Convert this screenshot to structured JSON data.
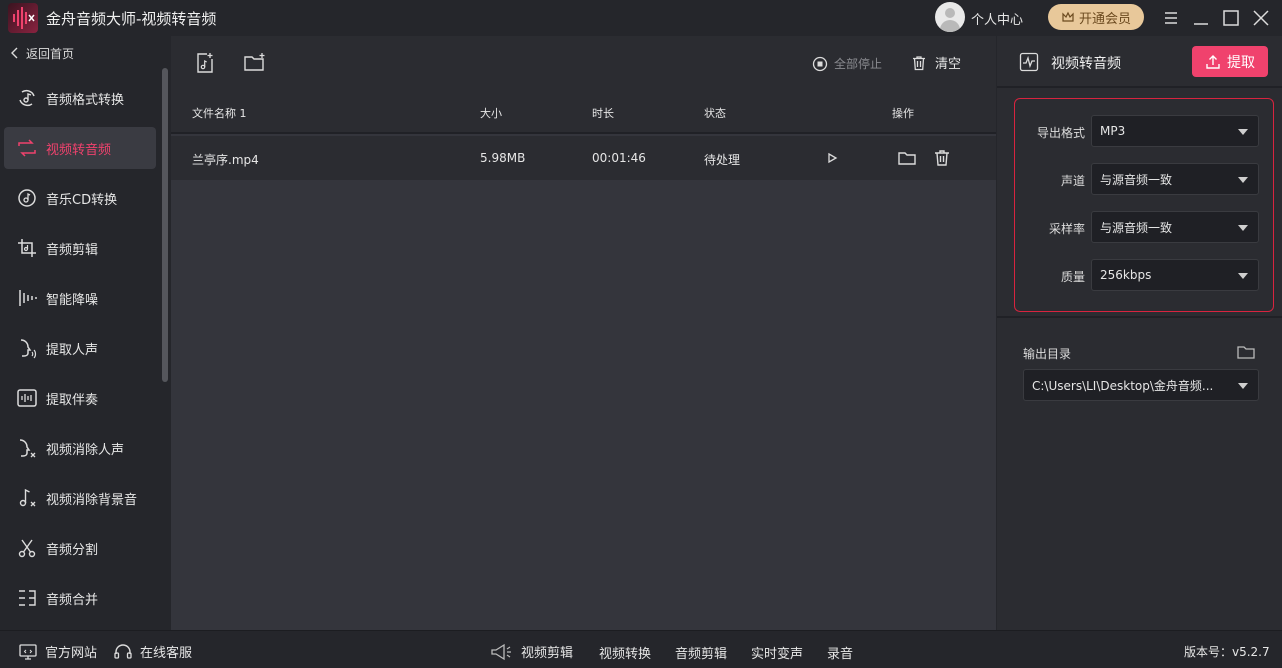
{
  "titlebar": {
    "app_title": "金舟音频大师-视频转音频",
    "user_center": "个人中心",
    "vip_button": "开通会员",
    "icons": [
      "menu-icon",
      "minimize-icon",
      "maximize-icon",
      "close-icon"
    ]
  },
  "sidebar": {
    "back_label": "返回首页",
    "items": [
      {
        "label": "音频格式转换",
        "icon": "audio-convert-icon",
        "active": false
      },
      {
        "label": "视频转音频",
        "icon": "video-to-audio-icon",
        "active": true
      },
      {
        "label": "音乐CD转换",
        "icon": "cd-icon",
        "active": false
      },
      {
        "label": "音频剪辑",
        "icon": "audio-cut-icon",
        "active": false
      },
      {
        "label": "智能降噪",
        "icon": "denoise-icon",
        "active": false
      },
      {
        "label": "提取人声",
        "icon": "vocal-extract-icon",
        "active": false
      },
      {
        "label": "提取伴奏",
        "icon": "accompaniment-icon",
        "active": false
      },
      {
        "label": "视频消除人声",
        "icon": "remove-vocal-icon",
        "active": false
      },
      {
        "label": "视频消除背景音",
        "icon": "remove-bg-sound-icon",
        "active": false
      },
      {
        "label": "音频分割",
        "icon": "split-icon",
        "active": false
      },
      {
        "label": "音频合并",
        "icon": "merge-icon",
        "active": false
      }
    ]
  },
  "toolbar": {
    "stop_all": "全部停止",
    "clear": "清空"
  },
  "table": {
    "headers": {
      "name": "文件名称 1",
      "size": "大小",
      "duration": "时长",
      "status": "状态",
      "actions": "操作"
    },
    "rows": [
      {
        "name": "兰亭序.mp4",
        "size": "5.98MB",
        "duration": "00:01:46",
        "status": "待处理"
      }
    ]
  },
  "right_panel": {
    "title": "视频转音频",
    "extract_button": "提取",
    "settings": {
      "format_label": "导出格式",
      "format_value": "MP3",
      "channel_label": "声道",
      "channel_value": "与源音频一致",
      "samplerate_label": "采样率",
      "samplerate_value": "与源音频一致",
      "quality_label": "质量",
      "quality_value": "256kbps"
    },
    "output_label": "输出目录",
    "output_path": "C:\\Users\\LI\\Desktop\\金舟音频..."
  },
  "bottombar": {
    "website": "官方网站",
    "support": "在线客服",
    "links": [
      "视频剪辑",
      "视频转换",
      "音频剪辑",
      "实时变声",
      "录音"
    ],
    "version": "版本号：v5.2.7"
  },
  "colors": {
    "accent": "#f0426d",
    "border_highlight": "#d8243f",
    "vip_gold": "#e8c89a"
  }
}
